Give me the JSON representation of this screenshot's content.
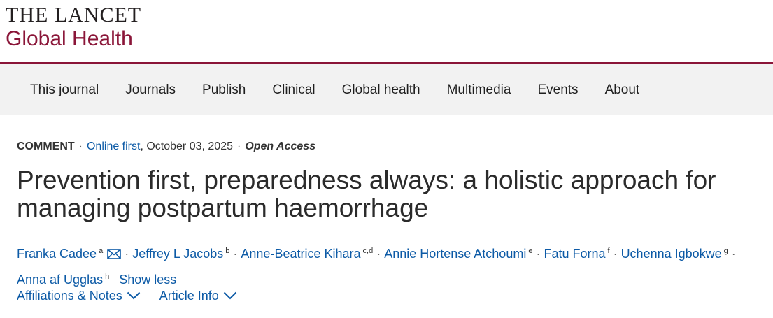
{
  "brand": {
    "line1": "THE LANCET",
    "line2": "Global Health"
  },
  "nav": {
    "items": [
      "This journal",
      "Journals",
      "Publish",
      "Clinical",
      "Global health",
      "Multimedia",
      "Events",
      "About"
    ]
  },
  "article": {
    "type": "COMMENT",
    "separator": "·",
    "status": "Online first",
    "date": ", October 03, 2025",
    "access": "Open Access",
    "title": "Prevention first, preparedness always: a holistic approach for managing postpartum haemorrhage",
    "authors": [
      {
        "name": "Franka Cadee",
        "sup": "a"
      },
      {
        "name": "Jeffrey L Jacobs",
        "sup": "b"
      },
      {
        "name": "Anne-Beatrice Kihara",
        "sup": "c,d"
      },
      {
        "name": "Annie Hortense Atchoumi",
        "sup": "e"
      },
      {
        "name": "Fatu Forna",
        "sup": "f"
      },
      {
        "name": "Uchenna Igbokwe",
        "sup": "g"
      },
      {
        "name": "Anna af Ugglas",
        "sup": "h"
      }
    ],
    "show_less": "Show less",
    "affiliations_label": "Affiliations & Notes",
    "article_info_label": "Article Info"
  },
  "colors": {
    "brand": "#8a1538",
    "link": "#0c5aa6",
    "nav_bg": "#f2f2f2"
  },
  "icons": {
    "email": "envelope-icon",
    "expand": "chevron-down-icon"
  }
}
